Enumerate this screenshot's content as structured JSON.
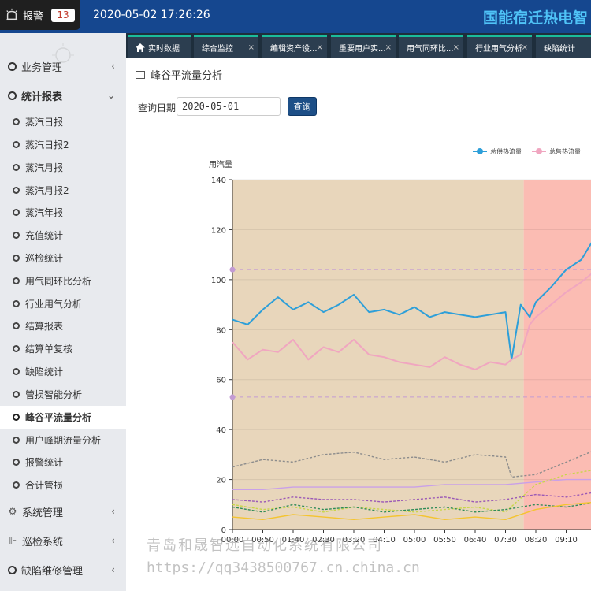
{
  "header": {
    "alarm_label": "报警",
    "alarm_count": "13",
    "datetime": "2020-05-02 17:26:26",
    "brand": "国能宿迁热电智"
  },
  "sidebar": {
    "groups": [
      {
        "label": "业务管理"
      },
      {
        "label": "统计报表"
      },
      {
        "label": "系统管理"
      },
      {
        "label": "巡检系统"
      },
      {
        "label": "缺陷维修管理"
      }
    ],
    "items": [
      {
        "label": "蒸汽日报"
      },
      {
        "label": "蒸汽日报2"
      },
      {
        "label": "蒸汽月报"
      },
      {
        "label": "蒸汽月报2"
      },
      {
        "label": "蒸汽年报"
      },
      {
        "label": "充值统计"
      },
      {
        "label": "巡检统计"
      },
      {
        "label": "用气同环比分析"
      },
      {
        "label": "行业用气分析"
      },
      {
        "label": "结算报表"
      },
      {
        "label": "结算单复核"
      },
      {
        "label": "缺陷统计"
      },
      {
        "label": "管损智能分析"
      },
      {
        "label": "峰谷平流量分析"
      },
      {
        "label": "用户峰期流量分析"
      },
      {
        "label": "报警统计"
      },
      {
        "label": "合计管损"
      }
    ]
  },
  "tabs": [
    {
      "label": "实时数据"
    },
    {
      "label": "综合监控"
    },
    {
      "label": "编辑资产设..."
    },
    {
      "label": "重要用户实..."
    },
    {
      "label": "用气同环比..."
    },
    {
      "label": "行业用气分析"
    },
    {
      "label": "缺陷统计"
    }
  ],
  "page": {
    "title": "峰谷平流量分析",
    "query_label": "查询日期:",
    "query_date": "2020-05-01",
    "query_button": "查询"
  },
  "watermark": {
    "line1": "青岛和晟智远自动化系统有限公司",
    "line2": "https://qq3438500767.cn.china.cn"
  },
  "chart_data": {
    "type": "line",
    "ylabel": "用汽量",
    "ylim": [
      0,
      140
    ],
    "yticks": [
      0,
      20,
      40,
      60,
      80,
      100,
      120,
      140
    ],
    "xticks": [
      "00:00",
      "00:50",
      "01:40",
      "02:30",
      "03:20",
      "04:10",
      "05:00",
      "05:50",
      "06:40",
      "07:30",
      "08:20",
      "09:10",
      "1"
    ],
    "legend": [
      "总供热流量",
      "总售热流量"
    ],
    "legend_position": "top-right",
    "markline_values": [
      104,
      53
    ],
    "colors": {
      "valley_band": "#e8d6bb",
      "peak_band": "#fbbcb3",
      "supply": "#2d9fd9",
      "sale": "#f0a6c0"
    },
    "valley_end_time": "08:00",
    "series": [
      {
        "name": "总供热流量",
        "color": "#2d9fd9",
        "dashed": false,
        "x": [
          "00:00",
          "00:25",
          "00:50",
          "01:15",
          "01:40",
          "02:05",
          "02:30",
          "02:55",
          "03:20",
          "03:45",
          "04:10",
          "04:35",
          "05:00",
          "05:25",
          "05:50",
          "06:15",
          "06:40",
          "07:05",
          "07:30",
          "07:40",
          "07:55",
          "08:10",
          "08:20",
          "08:45",
          "09:10",
          "09:35",
          "10:00"
        ],
        "values": [
          84,
          82,
          88,
          93,
          88,
          91,
          87,
          90,
          94,
          87,
          88,
          86,
          89,
          85,
          87,
          86,
          85,
          86,
          87,
          68,
          90,
          85,
          91,
          97,
          104,
          108,
          118
        ]
      },
      {
        "name": "总售热流量",
        "color": "#f0a6c0",
        "dashed": false,
        "x": [
          "00:00",
          "00:25",
          "00:50",
          "01:15",
          "01:40",
          "02:05",
          "02:30",
          "02:55",
          "03:20",
          "03:45",
          "04:10",
          "04:35",
          "05:00",
          "05:25",
          "05:50",
          "06:15",
          "06:40",
          "07:05",
          "07:30",
          "07:40",
          "07:55",
          "08:10",
          "08:20",
          "08:45",
          "09:10",
          "09:35",
          "10:00"
        ],
        "values": [
          75,
          68,
          72,
          71,
          76,
          68,
          73,
          71,
          76,
          70,
          69,
          67,
          66,
          65,
          69,
          66,
          64,
          67,
          66,
          68,
          70,
          82,
          85,
          90,
          95,
          99,
          104
        ]
      },
      {
        "color": "#8c8c8c",
        "dashed": true,
        "x": [
          "00:00",
          "00:50",
          "01:40",
          "02:30",
          "03:20",
          "04:10",
          "05:00",
          "05:50",
          "06:40",
          "07:30",
          "07:40",
          "08:20",
          "09:10",
          "10:00"
        ],
        "values": [
          25,
          28,
          27,
          30,
          31,
          28,
          29,
          27,
          30,
          29,
          21,
          22,
          27,
          32
        ]
      },
      {
        "color": "#c9a0e8",
        "dashed": false,
        "x": [
          "00:00",
          "00:50",
          "01:40",
          "02:30",
          "03:20",
          "04:10",
          "05:00",
          "05:50",
          "06:40",
          "07:30",
          "08:20",
          "09:10",
          "10:00"
        ],
        "values": [
          16,
          16,
          17,
          17,
          17,
          17,
          17,
          18,
          18,
          18,
          19,
          20,
          20
        ]
      },
      {
        "color": "#c9d64a",
        "dashed": true,
        "x": [
          "00:00",
          "00:50",
          "01:40",
          "02:30",
          "03:20",
          "04:10",
          "05:00",
          "05:50",
          "06:40",
          "07:30",
          "08:20",
          "09:10",
          "10:00"
        ],
        "values": [
          10,
          8,
          9,
          7,
          9,
          8,
          7,
          8,
          9,
          7,
          18,
          22,
          24
        ]
      },
      {
        "color": "#2e8b57",
        "dashed": true,
        "x": [
          "00:00",
          "00:50",
          "01:40",
          "02:30",
          "03:20",
          "04:10",
          "05:00",
          "05:50",
          "06:40",
          "07:30",
          "08:20",
          "09:10",
          "10:00"
        ],
        "values": [
          9,
          7,
          10,
          8,
          9,
          7,
          8,
          9,
          7,
          8,
          10,
          9,
          11
        ]
      },
      {
        "color": "#9b59b6",
        "dashed": true,
        "x": [
          "00:00",
          "00:50",
          "01:40",
          "02:30",
          "03:20",
          "04:10",
          "05:00",
          "05:50",
          "06:40",
          "07:30",
          "08:20",
          "09:10",
          "10:00"
        ],
        "values": [
          12,
          11,
          13,
          12,
          12,
          11,
          12,
          13,
          11,
          12,
          14,
          13,
          15
        ]
      },
      {
        "color": "#f4c430",
        "dashed": false,
        "x": [
          "00:00",
          "00:50",
          "01:40",
          "02:30",
          "03:20",
          "04:10",
          "05:00",
          "05:50",
          "06:40",
          "07:30",
          "08:20",
          "09:10",
          "10:00"
        ],
        "values": [
          5,
          4,
          6,
          5,
          4,
          5,
          6,
          4,
          5,
          4,
          8,
          10,
          11
        ]
      }
    ]
  }
}
